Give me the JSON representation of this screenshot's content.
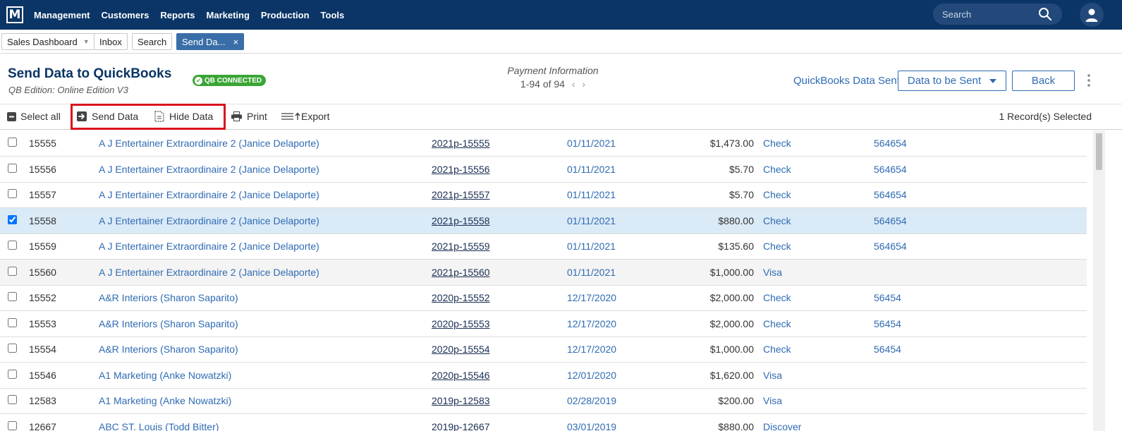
{
  "nav": {
    "logo_letter": "M",
    "menu": [
      "Management",
      "Customers",
      "Reports",
      "Marketing",
      "Production",
      "Tools"
    ],
    "search_placeholder": "Search"
  },
  "tabs": {
    "sales_dashboard": "Sales Dashboard",
    "inbox": "Inbox",
    "search": "Search",
    "active": "Send Da...",
    "close_glyph": "×",
    "caret_glyph": "▼"
  },
  "header": {
    "title": "Send Data to QuickBooks",
    "badge": "QB CONNECTED",
    "badge_icon": "check-circle-icon",
    "edition": "QB Edition: Online Edition V3",
    "center_label": "Payment Information",
    "count": "1-94 of 94",
    "qb_sent_link": "QuickBooks Data Sent",
    "dropdown_label": "Data to be Sent",
    "back_label": "Back"
  },
  "toolbar": {
    "select_all": "Select all",
    "send_data": "Send Data",
    "hide_data": "Hide Data",
    "print": "Print",
    "export": "Export",
    "records_selected": "1 Record(s) Selected"
  },
  "rows": [
    {
      "id": "15555",
      "customer": "A J Entertainer Extraordinaire 2 (Janice Delaporte)",
      "order": "2021p-15555",
      "date": "01/11/2021",
      "amount": "$1,473.00",
      "method": "Check",
      "ref": "564654",
      "checked": false
    },
    {
      "id": "15556",
      "customer": "A J Entertainer Extraordinaire 2 (Janice Delaporte)",
      "order": "2021p-15556",
      "date": "01/11/2021",
      "amount": "$5.70",
      "method": "Check",
      "ref": "564654",
      "checked": false
    },
    {
      "id": "15557",
      "customer": "A J Entertainer Extraordinaire 2 (Janice Delaporte)",
      "order": "2021p-15557",
      "date": "01/11/2021",
      "amount": "$5.70",
      "method": "Check",
      "ref": "564654",
      "checked": false
    },
    {
      "id": "15558",
      "customer": "A J Entertainer Extraordinaire 2 (Janice Delaporte)",
      "order": "2021p-15558",
      "date": "01/11/2021",
      "amount": "$880.00",
      "method": "Check",
      "ref": "564654",
      "checked": true
    },
    {
      "id": "15559",
      "customer": "A J Entertainer Extraordinaire 2 (Janice Delaporte)",
      "order": "2021p-15559",
      "date": "01/11/2021",
      "amount": "$135.60",
      "method": "Check",
      "ref": "564654",
      "checked": false
    },
    {
      "id": "15560",
      "customer": "A J Entertainer Extraordinaire 2 (Janice Delaporte)",
      "order": "2021p-15560",
      "date": "01/11/2021",
      "amount": "$1,000.00",
      "method": "Visa",
      "ref": "",
      "checked": false
    },
    {
      "id": "15552",
      "customer": "A&R Interiors (Sharon Saparito)",
      "order": "2020p-15552",
      "date": "12/17/2020",
      "amount": "$2,000.00",
      "method": "Check",
      "ref": "56454",
      "checked": false
    },
    {
      "id": "15553",
      "customer": "A&R Interiors (Sharon Saparito)",
      "order": "2020p-15553",
      "date": "12/17/2020",
      "amount": "$2,000.00",
      "method": "Check",
      "ref": "56454",
      "checked": false
    },
    {
      "id": "15554",
      "customer": "A&R Interiors (Sharon Saparito)",
      "order": "2020p-15554",
      "date": "12/17/2020",
      "amount": "$1,000.00",
      "method": "Check",
      "ref": "56454",
      "checked": false
    },
    {
      "id": "15546",
      "customer": "A1 Marketing (Anke Nowatzki)",
      "order": "2020p-15546",
      "date": "12/01/2020",
      "amount": "$1,620.00",
      "method": "Visa",
      "ref": "",
      "checked": false
    },
    {
      "id": "12583",
      "customer": "A1 Marketing (Anke Nowatzki)",
      "order": "2019p-12583",
      "date": "02/28/2019",
      "amount": "$200.00",
      "method": "Visa",
      "ref": "",
      "checked": false
    },
    {
      "id": "12667",
      "customer": "ABC ST. Louis (Todd Bitter)",
      "order": "2019p-12667",
      "date": "03/01/2019",
      "amount": "$880.00",
      "method": "Discover",
      "ref": "",
      "checked": false
    }
  ],
  "colors": {
    "nav_bg": "#0a3566",
    "link": "#2f6bb3",
    "badge_green": "#3aa535",
    "highlight_red": "#d9151c",
    "selected_row": "#dbeaf7"
  }
}
